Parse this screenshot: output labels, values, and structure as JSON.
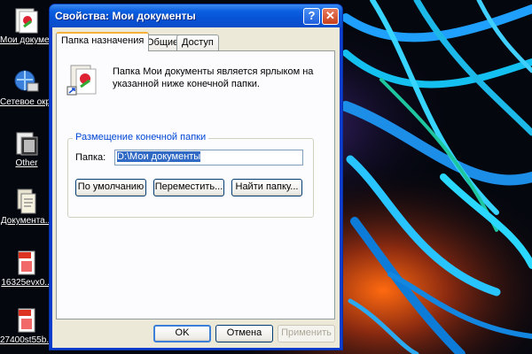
{
  "desktop": {
    "icons": [
      {
        "label": "Мои документы",
        "icon": "my-documents-icon"
      },
      {
        "label": "Сетевое окружение",
        "icon": "network-places-icon"
      },
      {
        "label": "Other",
        "icon": "folder-film-icon"
      },
      {
        "label": "Документа...",
        "icon": "documents-icon"
      },
      {
        "label": "16325evx0...",
        "icon": "jpg-file-icon"
      },
      {
        "label": "27400st55b...",
        "icon": "jpg-file-icon"
      }
    ]
  },
  "dialog": {
    "title": "Свойства: Мои документы",
    "help_btn": "?",
    "close_btn": "✕",
    "tabs": [
      {
        "label": "Папка назначения",
        "active": true
      },
      {
        "label": "Общие",
        "active": false
      },
      {
        "label": "Доступ",
        "active": false
      }
    ],
    "info_text": "Папка Мои документы является ярлыком на указанной ниже конечной папки.",
    "group": {
      "legend": "Размещение конечной папки",
      "path_label": "Папка:",
      "path_value": "D:\\Мои документы",
      "buttons": {
        "default": "По умолчанию",
        "move": "Переместить...",
        "find": "Найти папку..."
      }
    },
    "footer": {
      "ok": "OK",
      "cancel": "Отмена",
      "apply": "Применить"
    }
  },
  "colors": {
    "titlebar": "#0a5fe0",
    "dialog_bg": "#ece9d8",
    "group_legend": "#0046d5"
  }
}
